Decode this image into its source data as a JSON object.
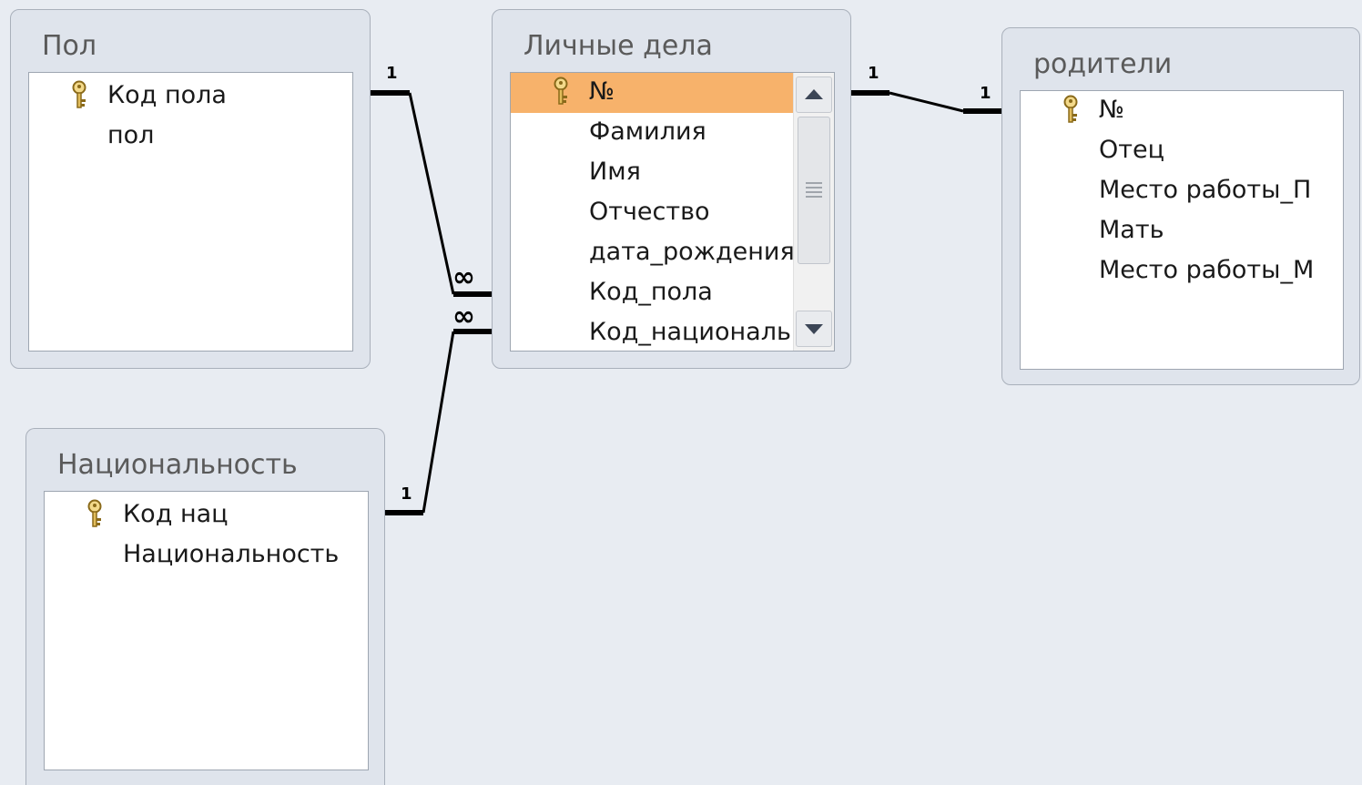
{
  "tables": {
    "pol": {
      "title": "Пол",
      "fields": [
        "Код пола",
        "пол"
      ]
    },
    "lichnye": {
      "title": "Личные дела",
      "fields": [
        "№",
        "Фамилия",
        "Имя",
        "Отчество",
        "дата_рождения",
        "Код_пола",
        "Код_национальн"
      ]
    },
    "roditeli": {
      "title": "родители",
      "fields": [
        "№",
        "Отец",
        "Место работы_П",
        "Мать",
        "Место работы_М"
      ]
    },
    "nats": {
      "title": "Национальность",
      "fields": [
        "Код нац",
        "Национальность"
      ]
    }
  },
  "relations": {
    "one": "1",
    "many": "∞"
  },
  "colors": {
    "background": "#e8ecf2",
    "selected_row": "#f7b26b",
    "key_icon": "#e8c36a"
  },
  "icons": [
    "key-icon",
    "scroll-up-icon",
    "scroll-down-icon",
    "scroll-grip-icon"
  ]
}
